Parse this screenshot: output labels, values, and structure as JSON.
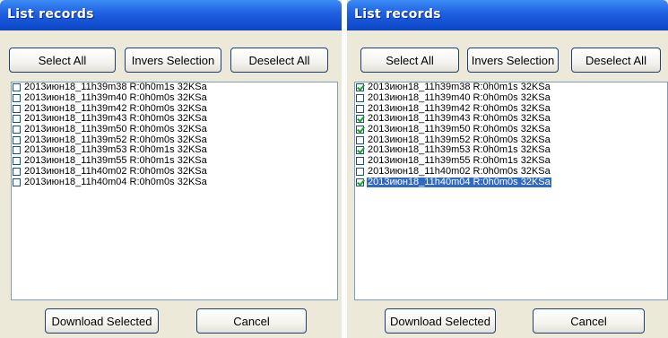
{
  "left_dialog": {
    "title": "List records",
    "buttons": {
      "select_all": "Select All",
      "invert": "Invers Selection",
      "deselect_all": "Deselect All"
    },
    "records": [
      {
        "label": "2013июн18_11h39m38 R:0h0m1s 32KSa",
        "checked": false
      },
      {
        "label": "2013июн18_11h39m40 R:0h0m0s 32KSa",
        "checked": false
      },
      {
        "label": "2013июн18_11h39m42 R:0h0m0s 32KSa",
        "checked": false
      },
      {
        "label": "2013июн18_11h39m43 R:0h0m0s 32KSa",
        "checked": false
      },
      {
        "label": "2013июн18_11h39m50 R:0h0m0s 32KSa",
        "checked": false
      },
      {
        "label": "2013июн18_11h39m52 R:0h0m0s 32KSa",
        "checked": false
      },
      {
        "label": "2013июн18_11h39m53 R:0h0m1s 32KSa",
        "checked": false
      },
      {
        "label": "2013июн18_11h39m55 R:0h0m1s 32KSa",
        "checked": false
      },
      {
        "label": "2013июн18_11h40m02 R:0h0m0s 32KSa",
        "checked": false
      },
      {
        "label": "2013июн18_11h40m04 R:0h0m0s 32KSa",
        "checked": false
      }
    ],
    "footer": {
      "download": "Download Selected",
      "cancel": "Cancel"
    }
  },
  "right_dialog": {
    "title": "List records",
    "buttons": {
      "select_all": "Select All",
      "invert": "Invers Selection",
      "deselect_all": "Deselect All"
    },
    "records": [
      {
        "label": "2013июн18_11h39m38 R:0h0m1s 32KSa",
        "checked": true
      },
      {
        "label": "2013июн18_11h39m40 R:0h0m0s 32KSa",
        "checked": false
      },
      {
        "label": "2013июн18_11h39m42 R:0h0m0s 32KSa",
        "checked": false
      },
      {
        "label": "2013июн18_11h39m43 R:0h0m0s 32KSa",
        "checked": true
      },
      {
        "label": "2013июн18_11h39m50 R:0h0m0s 32KSa",
        "checked": true
      },
      {
        "label": "2013июн18_11h39m52 R:0h0m0s 32KSa",
        "checked": false
      },
      {
        "label": "2013июн18_11h39m53 R:0h0m1s 32KSa",
        "checked": true
      },
      {
        "label": "2013июн18_11h39m55 R:0h0m1s 32KSa",
        "checked": false
      },
      {
        "label": "2013июн18_11h40m02 R:0h0m0s 32KSa",
        "checked": false
      },
      {
        "label": "2013июн18_11h40m04 R:0h0m0s 32KSa",
        "checked": true,
        "selected": true
      }
    ],
    "footer": {
      "download": "Download Selected",
      "cancel": "Cancel"
    }
  },
  "colors": {
    "titlebar": "#0b45c6",
    "dialog_bg": "#ece9d8",
    "selection": "#316ac5",
    "checkmark": "#21a121"
  }
}
